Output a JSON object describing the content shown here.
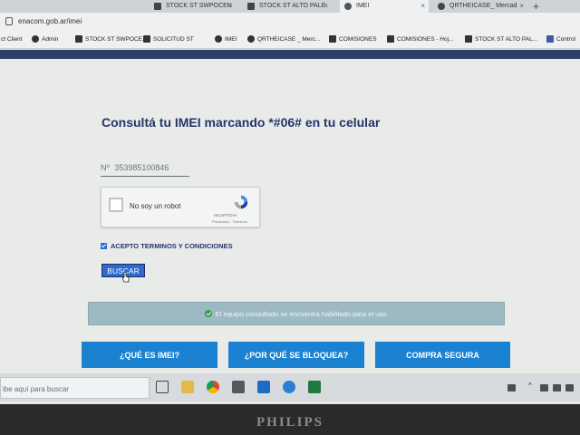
{
  "browser": {
    "tabs": [
      {
        "label": "STOCK ST SWPOCEN"
      },
      {
        "label": "STOCK ST ALTO PALE"
      },
      {
        "label": "IMEI"
      },
      {
        "label": "QRTHEICASE_ Mercad"
      }
    ],
    "new_tab_label": "+",
    "url": "enacom.gob.ar/imei",
    "bookmarks": [
      {
        "label": "ct Client"
      },
      {
        "label": "Admin"
      },
      {
        "label": "STOCK ST SWPOCE..."
      },
      {
        "label": "SOLICITUD ST"
      },
      {
        "label": "IMEI"
      },
      {
        "label": "QRTHEICASE _ Merc..."
      },
      {
        "label": "COMISIONES"
      },
      {
        "label": "COMISIONES - Hoj..."
      },
      {
        "label": "STOCK ST ALTO PAL..."
      },
      {
        "label": "Control"
      }
    ]
  },
  "page": {
    "title": "Consultá tu IMEI marcando *#06# en tu celular",
    "imei_field": {
      "prefix": "Nº",
      "value": "353985100846"
    },
    "recaptcha": {
      "label": "No soy un robot",
      "brand": "reCAPTCHA",
      "links": "Privacidad - Términos"
    },
    "terms_label": "ACEPTO TERMINOS Y CONDICIONES",
    "terms_checked": true,
    "search_button": "BUSCAR",
    "status_message": "El equipo consultado se encuentra habilitado para el uso.",
    "nav_buttons": [
      {
        "label": "¿QUÉ ES IMEI?"
      },
      {
        "label": "¿POR QUÉ SE BLOQUEA?"
      },
      {
        "label": "COMPRA SEGURA"
      }
    ],
    "colors": {
      "title": "#23356b",
      "button": "#2d6ac9",
      "nav_button": "#1b82d1",
      "status_bg": "#9db9c2"
    }
  },
  "taskbar": {
    "search_placeholder": "ibe aquí para buscar",
    "apps": [
      "task-view-icon",
      "file-explorer-icon",
      "chrome-icon",
      "calculator-icon",
      "clock-icon",
      "edge-icon",
      "excel-icon"
    ]
  },
  "monitor_brand": "PHILIPS"
}
